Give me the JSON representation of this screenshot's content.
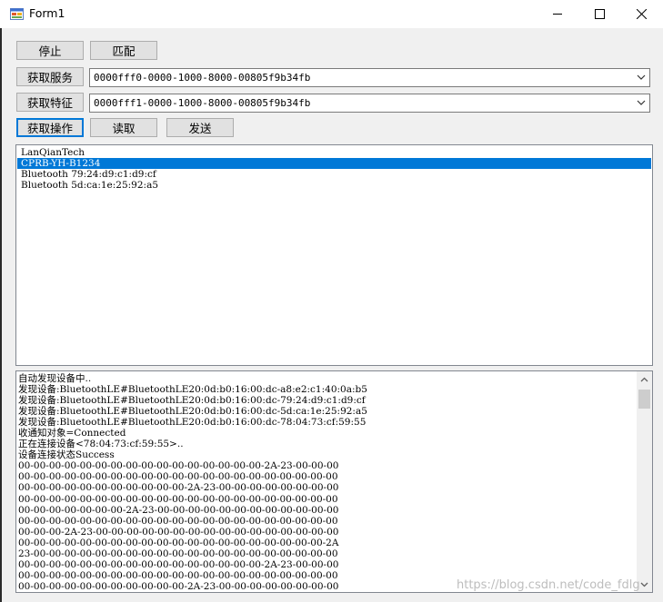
{
  "window": {
    "title": "Form1",
    "icon": "windows-form-icon",
    "minimize_icon": "minimize-icon",
    "maximize_icon": "maximize-icon",
    "close_icon": "close-icon"
  },
  "buttons": {
    "stop": "停止",
    "match": "匹配",
    "get_service": "获取服务",
    "get_characteristic": "获取特征",
    "get_operation": "获取操作",
    "read": "读取",
    "send": "发送"
  },
  "combos": {
    "service_value": "0000fff0-0000-1000-8000-00805f9b34fb",
    "characteristic_value": "0000fff1-0000-1000-8000-00805f9b34fb",
    "arrow_icon": "chevron-down-icon"
  },
  "device_list": {
    "items": [
      "LanQianTech",
      "CPRB-YH-B1234",
      "Bluetooth 79:24:d9:c1:d9:cf",
      "Bluetooth 5d:ca:1e:25:92:a5"
    ],
    "selected_index": 1
  },
  "log": {
    "lines": [
      "自动发现设备中..",
      "发现设备:BluetoothLE#BluetoothLE20:0d:b0:16:00:dc-a8:e2:c1:40:0a:b5",
      "发现设备:BluetoothLE#BluetoothLE20:0d:b0:16:00:dc-79:24:d9:c1:d9:cf",
      "发现设备:BluetoothLE#BluetoothLE20:0d:b0:16:00:dc-5d:ca:1e:25:92:a5",
      "发现设备:BluetoothLE#BluetoothLE20:0d:b0:16:00:dc-78:04:73:cf:59:55",
      "收通知对象=Connected",
      "正在连接设备<78:04:73:cf:59:55>..",
      "设备连接状态Success",
      "00-00-00-00-00-00-00-00-00-00-00-00-00-00-00-00-2A-23-00-00-00",
      "00-00-00-00-00-00-00-00-00-00-00-00-00-00-00-00-00-00-00-00-00",
      "00-00-00-00-00-00-00-00-00-00-00-2A-23-00-00-00-00-00-00-00-00",
      "00-00-00-00-00-00-00-00-00-00-00-00-00-00-00-00-00-00-00-00-00",
      "00-00-00-00-00-00-00-2A-23-00-00-00-00-00-00-00-00-00-00-00-00",
      "00-00-00-00-00-00-00-00-00-00-00-00-00-00-00-00-00-00-00-00-00",
      "00-00-00-2A-23-00-00-00-00-00-00-00-00-00-00-00-00-00-00-00-00",
      "00-00-00-00-00-00-00-00-00-00-00-00-00-00-00-00-00-00-00-00-2A",
      "23-00-00-00-00-00-00-00-00-00-00-00-00-00-00-00-00-00-00-00-00",
      "00-00-00-00-00-00-00-00-00-00-00-00-00-00-00-00-2A-23-00-00-00",
      "00-00-00-00-00-00-00-00-00-00-00-00-00-00-00-00-00-00-00-00-00",
      "00-00-00-00-00-00-00-00-00-00-00-2A-23-00-00-00-00-00-00-00-00"
    ],
    "scroll_up_icon": "scroll-up-arrow-icon",
    "scroll_down_icon": "scroll-down-arrow-icon"
  },
  "watermark": "https://blog.csdn.net/code_fdlg"
}
